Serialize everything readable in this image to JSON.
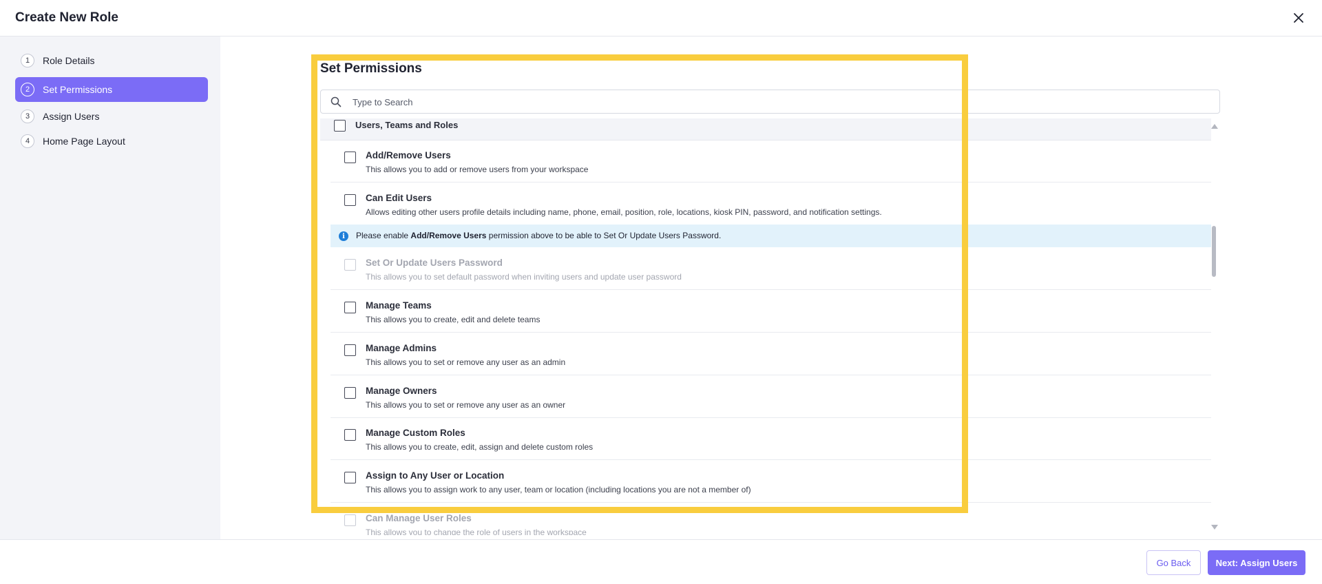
{
  "header": {
    "title": "Create New Role",
    "close_icon": "close-icon"
  },
  "steps": [
    {
      "num": "1",
      "label": "Role Details",
      "active": false
    },
    {
      "num": "2",
      "label": "Set Permissions",
      "active": true
    },
    {
      "num": "3",
      "label": "Assign Users",
      "active": false
    },
    {
      "num": "4",
      "label": "Home Page Layout",
      "active": false
    }
  ],
  "permissions": {
    "title": "Set Permissions",
    "search_placeholder": "Type to Search",
    "search_value": "",
    "group": {
      "label": "Users, Teams and Roles",
      "checked": false
    },
    "info_banner": {
      "prefix": "Please enable ",
      "bold": "Add/Remove Users",
      "suffix": " permission above to be able to Set Or Update Users Password."
    },
    "items": [
      {
        "title": "Add/Remove Users",
        "desc": "This allows you to add or remove users from your workspace",
        "checked": false,
        "disabled": false
      },
      {
        "title": "Can Edit Users",
        "desc": "Allows editing other users profile details including name, phone, email, position, role, locations, kiosk PIN, password, and notification settings.",
        "checked": false,
        "disabled": false
      },
      {
        "title": "Set Or Update Users Password",
        "desc": "This allows you to set default password when inviting users and update user password",
        "checked": false,
        "disabled": true
      },
      {
        "title": "Manage Teams",
        "desc": "This allows you to create, edit and delete teams",
        "checked": false,
        "disabled": false
      },
      {
        "title": "Manage Admins",
        "desc": "This allows you to set or remove any user as an admin",
        "checked": false,
        "disabled": false
      },
      {
        "title": "Manage Owners",
        "desc": "This allows you to set or remove any user as an owner",
        "checked": false,
        "disabled": false
      },
      {
        "title": "Manage Custom Roles",
        "desc": "This allows you to create, edit, assign and delete custom roles",
        "checked": false,
        "disabled": false
      },
      {
        "title": "Assign to Any User or Location",
        "desc": "This allows you to assign work to any user, team or location (including locations you are not a member of)",
        "checked": false,
        "disabled": false
      },
      {
        "title": "Can Manage User Roles",
        "desc": "This allows you to change the role of users in the workspace",
        "checked": false,
        "disabled": true
      }
    ]
  },
  "footer": {
    "back_label": "Go Back",
    "next_label": "Next: Assign Users"
  },
  "colors": {
    "accent": "#7b6cf6",
    "highlight": "#f9cd3e",
    "info_bg": "#e2f2fb",
    "sidebar_bg": "#f3f4f8"
  }
}
